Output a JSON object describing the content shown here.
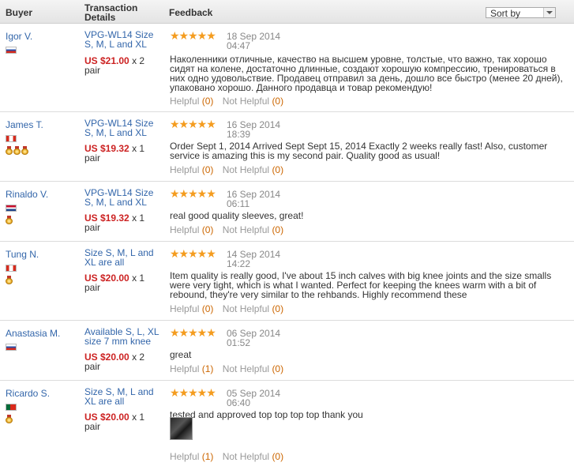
{
  "header": {
    "buyer": "Buyer",
    "transaction": "Transaction Details",
    "feedback": "Feedback",
    "sort_label": "Sort by"
  },
  "helpful_label": "Helpful",
  "not_helpful_label": "Not Helpful",
  "reviews": [
    {
      "buyer": "Igor V.",
      "flag": "ru-flag",
      "medals": 0,
      "product": "VPG-WL14 Size S, M, L and XL",
      "price": "US $21.00",
      "qty": "x 2",
      "unit": "pair",
      "stars": "★★★★★",
      "date": "18 Sep 2014",
      "time": "04:47",
      "text": "Наколенники отличные, качество на высшем уровне, толстые, что важно, так хорошо сидят на колене, достаточно длинные, создают хорошую компрессию, тренироваться в них одно удовольствие. Продавец отправил за день, дошло все быстро (менее 20 дней), упаковано хорошо. Данного продавца и товар рекомендую!",
      "helpful": "(0)",
      "not_helpful": "(0)"
    },
    {
      "buyer": "James T.",
      "flag": "ca-flag",
      "medals": 3,
      "product": "VPG-WL14 Size S, M, L and XL",
      "price": "US $19.32",
      "qty": "x 1",
      "unit": "pair",
      "stars": "★★★★★",
      "date": "16 Sep 2014",
      "time": "18:39",
      "text": "Order Sept 1, 2014 Arrived Sept Sept 15, 2014 Exactly 2 weeks really fast! Also, customer service is amazing this is my second pair. Quality good as usual!",
      "helpful": "(0)",
      "not_helpful": "(0)"
    },
    {
      "buyer": "Rinaldo V.",
      "flag": "nl-flag",
      "medals": 1,
      "product": "VPG-WL14 Size S, M, L and XL",
      "price": "US $19.32",
      "qty": "x 1",
      "unit": "pair",
      "stars": "★★★★★",
      "date": "16 Sep 2014",
      "time": "06:11",
      "text": "real good quality sleeves, great!",
      "helpful": "(0)",
      "not_helpful": "(0)"
    },
    {
      "buyer": "Tung N.",
      "flag": "ca-flag",
      "medals": 1,
      "product": "Size S, M, L and XL are all",
      "price": "US $20.00",
      "qty": "x 1",
      "unit": "pair",
      "stars": "★★★★★",
      "date": "14 Sep 2014",
      "time": "14:22",
      "text": "Item quality is really good, I've about 15 inch calves with big knee joints and the size smalls were very tight, which is what I wanted. Perfect for keeping the knees warm with a bit of rebound, they're very similar to the rehbands. Highly recommend these",
      "helpful": "(0)",
      "not_helpful": "(0)"
    },
    {
      "buyer": "Anastasia M.",
      "flag": "ru-flag",
      "medals": 0,
      "product": "Available S, L, XL size 7 mm knee",
      "price": "US $20.00",
      "qty": "x 2",
      "unit": "pair",
      "stars": "★★★★★",
      "date": "06 Sep 2014",
      "time": "01:52",
      "text": "great",
      "helpful": "(1)",
      "not_helpful": "(0)"
    },
    {
      "buyer": "Ricardo S.",
      "flag": "pt-flag",
      "medals": 1,
      "product": "Size S, M, L and XL are all",
      "price": "US $20.00",
      "qty": "x 1",
      "unit": "pair",
      "stars": "★★★★★",
      "date": "05 Sep 2014",
      "time": "06:40",
      "text": "tested and approved top top top top thank you",
      "helpful": "(1)",
      "not_helpful": "(0)"
    }
  ]
}
